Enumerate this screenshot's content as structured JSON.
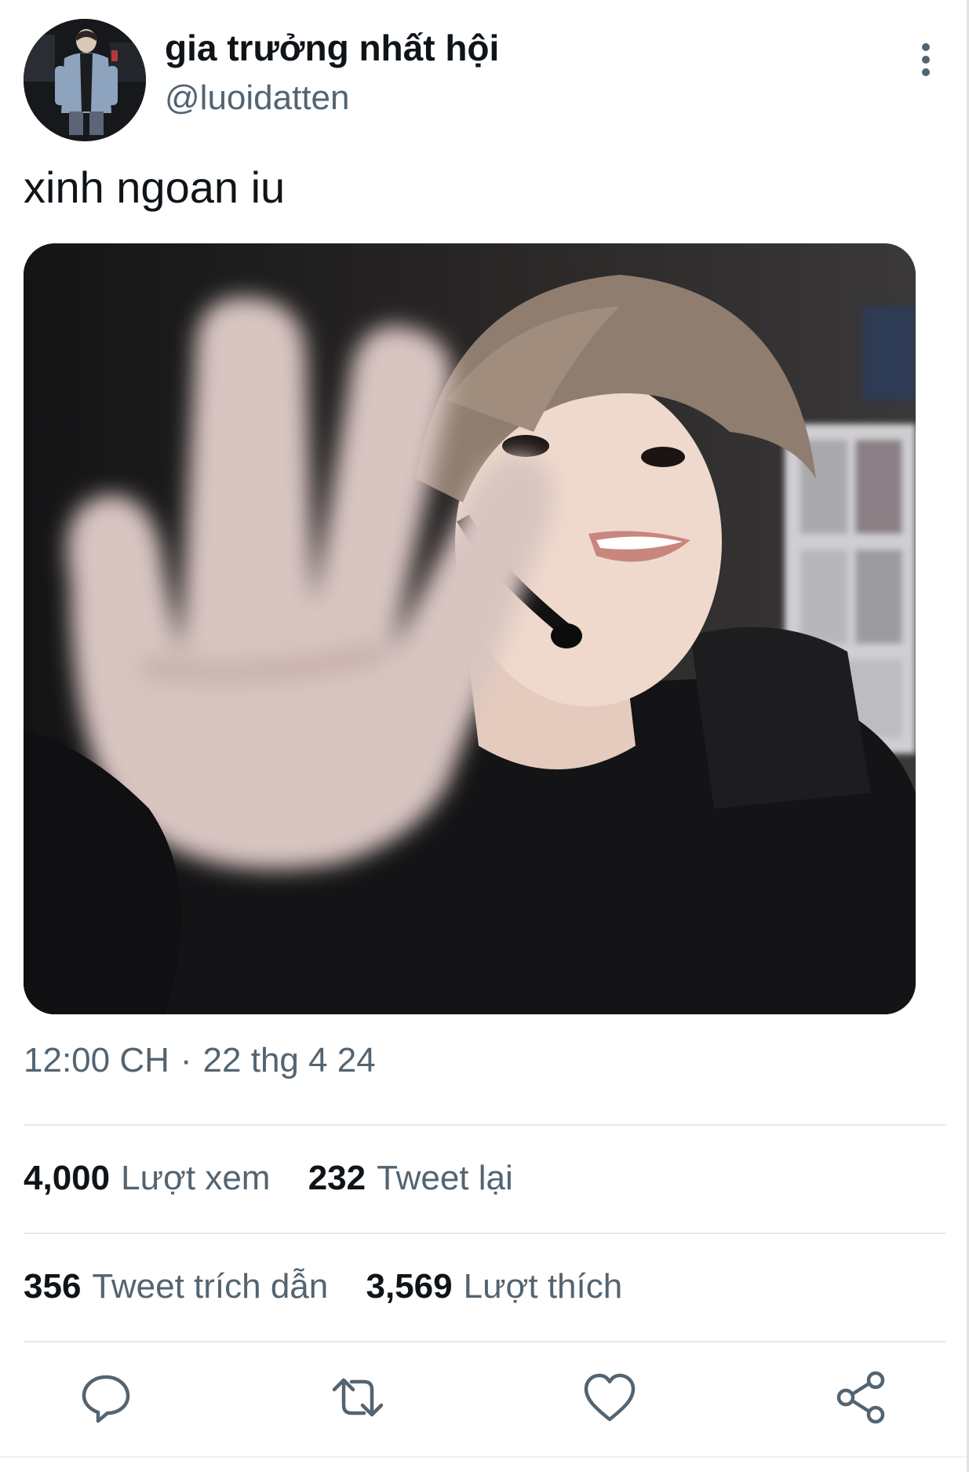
{
  "author": {
    "display_name": "gia trưởng nhất hội",
    "handle": "@luoidatten"
  },
  "tweet": {
    "text": "xinh ngoan iu",
    "time": "12:00 CH",
    "separator": "·",
    "date": "22 thg 4 24"
  },
  "stats": {
    "views": {
      "count": "4,000",
      "label": "Lượt xem"
    },
    "retweets": {
      "count": "232",
      "label": "Tweet lại"
    },
    "quotes": {
      "count": "356",
      "label": "Tweet trích dẫn"
    },
    "likes": {
      "count": "3,569",
      "label": "Lượt thích"
    }
  },
  "icons": {
    "more": "more-vertical-icon",
    "reply": "reply-icon",
    "retweet": "retweet-icon",
    "like": "heart-icon",
    "share": "share-icon"
  },
  "colors": {
    "text_primary": "#0f1419",
    "text_secondary": "#536471",
    "icon": "#536471",
    "divider": "#e6e9eb"
  }
}
